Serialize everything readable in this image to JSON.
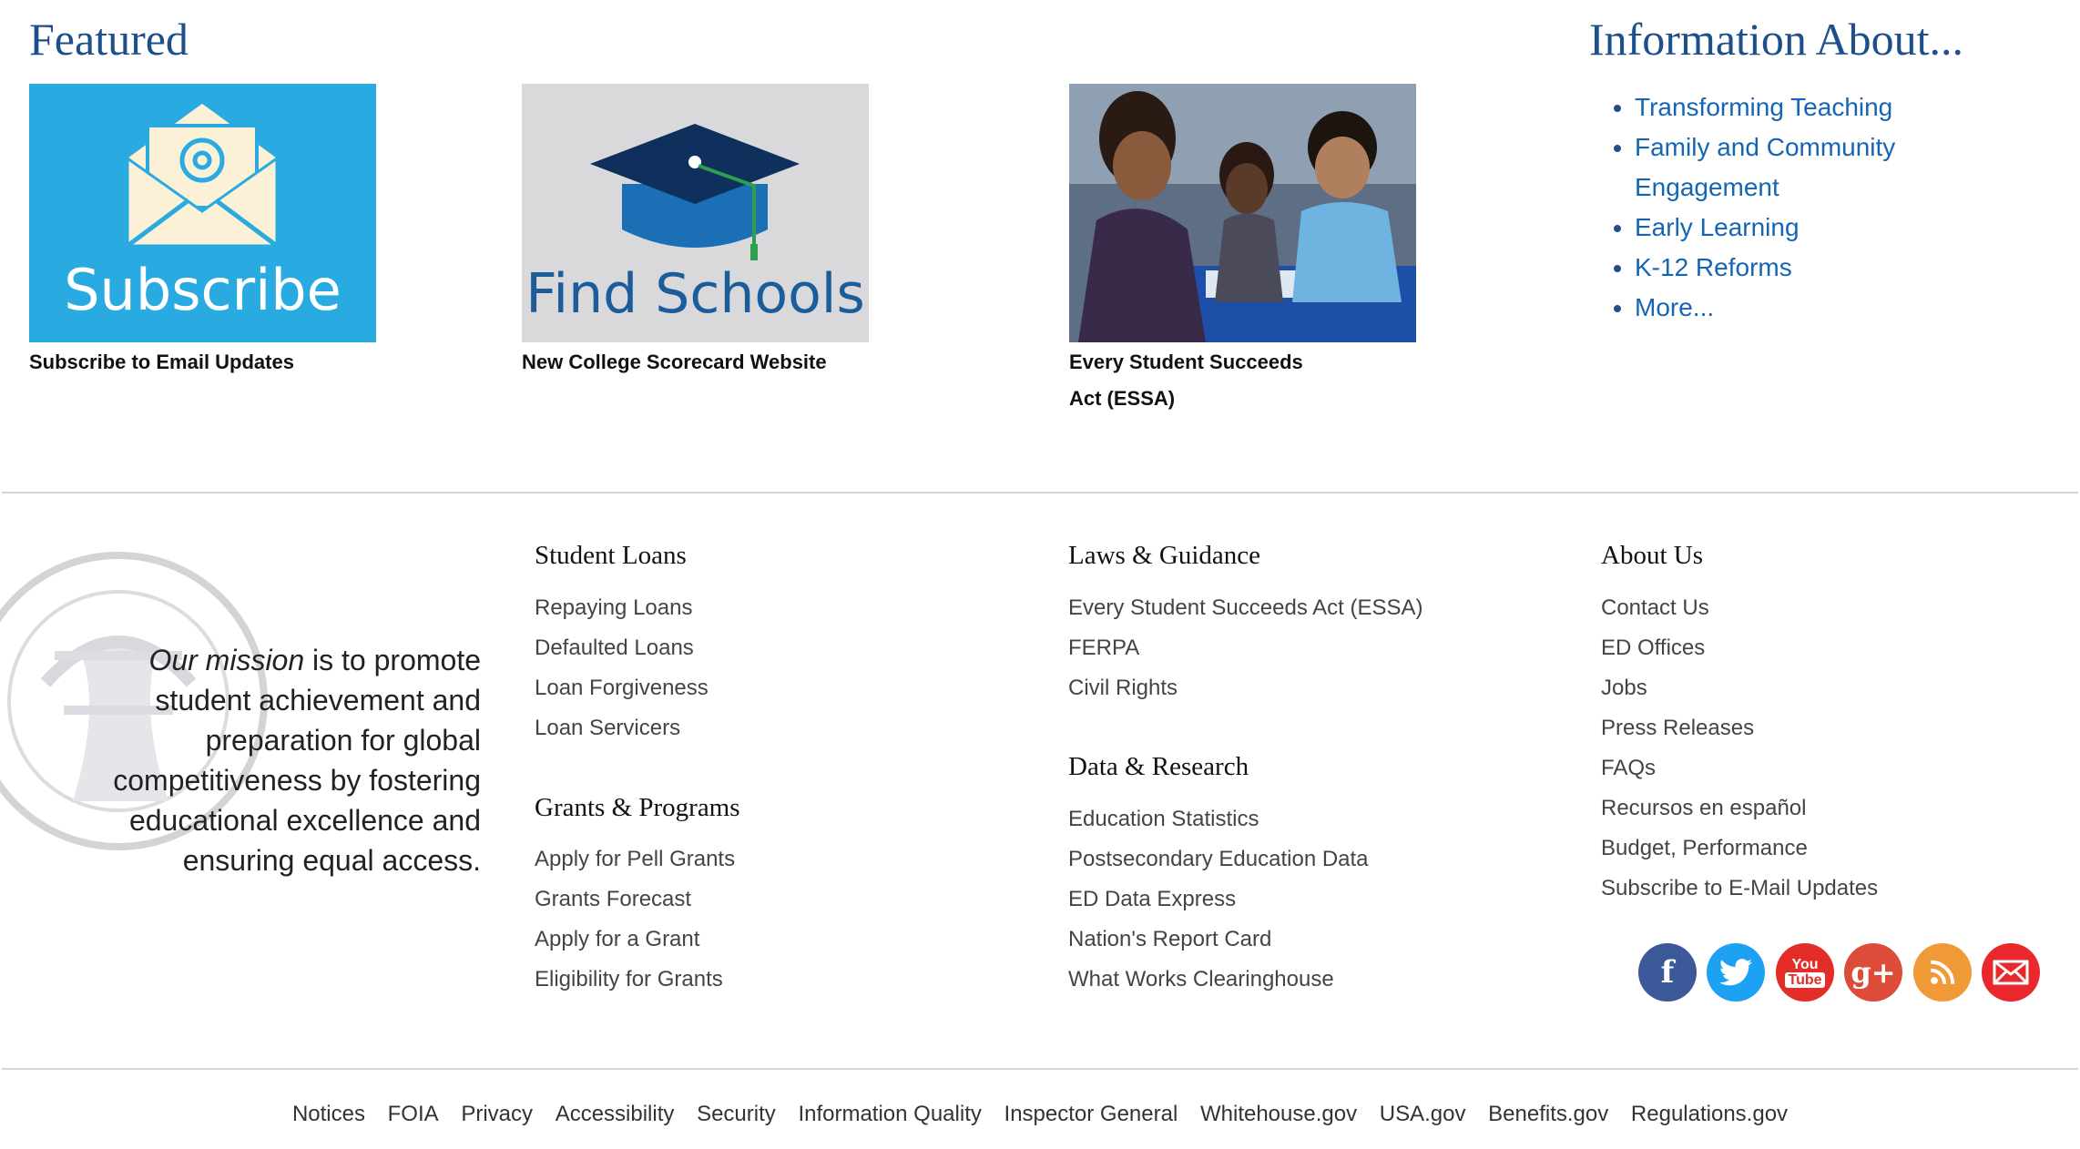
{
  "featured": {
    "title": "Featured",
    "cards": [
      {
        "image_text": "Subscribe",
        "caption": "Subscribe to Email Updates"
      },
      {
        "image_text": "Find Schools",
        "caption": "New College Scorecard Website"
      },
      {
        "caption": "Every Student Succeeds Act (ESSA)"
      }
    ]
  },
  "info": {
    "title": "Information About...",
    "items": [
      "Transforming Teaching",
      "Family and Community Engagement",
      "Early Learning",
      "K-12 Reforms",
      "More..."
    ]
  },
  "mission": {
    "lead": "Our mission",
    "rest": " is to promote student achievement and preparation for global competitiveness by fostering educational excellence and ensuring equal access."
  },
  "columns": {
    "student_loans": {
      "title": "Student Loans",
      "links": [
        "Repaying Loans",
        "Defaulted Loans",
        "Loan Forgiveness",
        "Loan Servicers"
      ]
    },
    "grants": {
      "title": "Grants & Programs",
      "links": [
        "Apply for Pell Grants",
        "Grants Forecast",
        "Apply for a Grant",
        "Eligibility for Grants"
      ]
    },
    "laws": {
      "title": "Laws & Guidance",
      "links": [
        "Every Student Succeeds Act (ESSA)",
        "FERPA",
        "Civil Rights"
      ]
    },
    "data": {
      "title": "Data & Research",
      "links": [
        "Education Statistics",
        "Postsecondary Education Data",
        "ED Data Express",
        "Nation's Report Card",
        "What Works Clearinghouse"
      ]
    },
    "about": {
      "title": "About Us",
      "links": [
        "Contact Us",
        "ED Offices",
        "Jobs",
        "Press Releases",
        "FAQs",
        "Recursos en español",
        "Budget, Performance",
        "Subscribe to E-Mail Updates"
      ]
    }
  },
  "social": {
    "facebook": {
      "glyph": "f",
      "color": "#3b5998"
    },
    "twitter": {
      "color": "#1da1f2"
    },
    "youtube": {
      "glyph_top": "You",
      "glyph_bottom": "Tube",
      "color": "#e52d27"
    },
    "googleplus": {
      "glyph": "g+",
      "color": "#dd4b39"
    },
    "rss": {
      "color": "#f09a37"
    },
    "email": {
      "color": "#e8282c"
    }
  },
  "bottom_links": [
    "Notices",
    "FOIA",
    "Privacy",
    "Accessibility",
    "Security",
    "Information Quality",
    "Inspector General",
    "Whitehouse.gov",
    "USA.gov",
    "Benefits.gov",
    "Regulations.gov"
  ]
}
